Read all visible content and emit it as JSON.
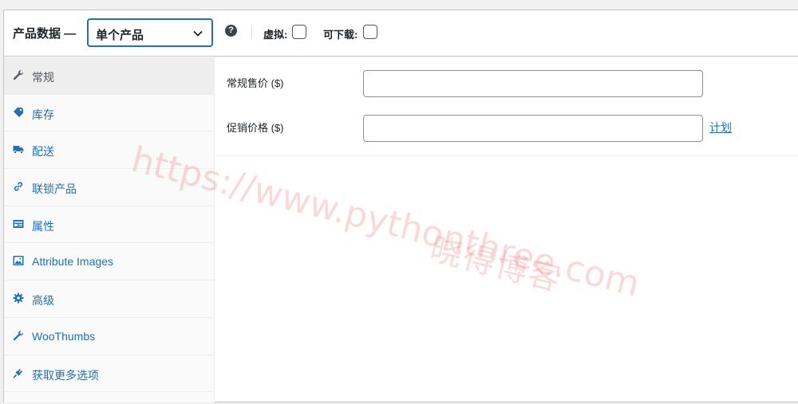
{
  "header": {
    "title": "产品数据 —",
    "product_type": "单个产品",
    "virtual_label": "虚拟:",
    "downloadable_label": "可下载:"
  },
  "sidebar": {
    "items": [
      {
        "label": "常规",
        "icon": "wrench-icon",
        "active": true
      },
      {
        "label": "库存",
        "icon": "tag-icon",
        "active": false
      },
      {
        "label": "配送",
        "icon": "truck-icon",
        "active": false
      },
      {
        "label": "联锁产品",
        "icon": "link-icon",
        "active": false
      },
      {
        "label": "属性",
        "icon": "attributes-icon",
        "active": false
      },
      {
        "label": "Attribute Images",
        "icon": "image-icon",
        "active": false
      },
      {
        "label": "高级",
        "icon": "gear-icon",
        "active": false
      },
      {
        "label": "WooThumbs",
        "icon": "wrench-icon",
        "active": false
      },
      {
        "label": "获取更多选项",
        "icon": "plugin-icon",
        "active": false
      }
    ]
  },
  "general": {
    "regular_price_label": "常规售价 ($)",
    "regular_price_value": "",
    "sale_price_label": "促销价格 ($)",
    "sale_price_value": "",
    "schedule_link": "计划"
  },
  "watermark": {
    "url": "https://www.pythonthree.com",
    "name": "晓得博客"
  },
  "colors": {
    "accent": "#2271b1",
    "text": "#1d2327",
    "border": "#c3c4c7",
    "watermark": "#ec7878"
  }
}
